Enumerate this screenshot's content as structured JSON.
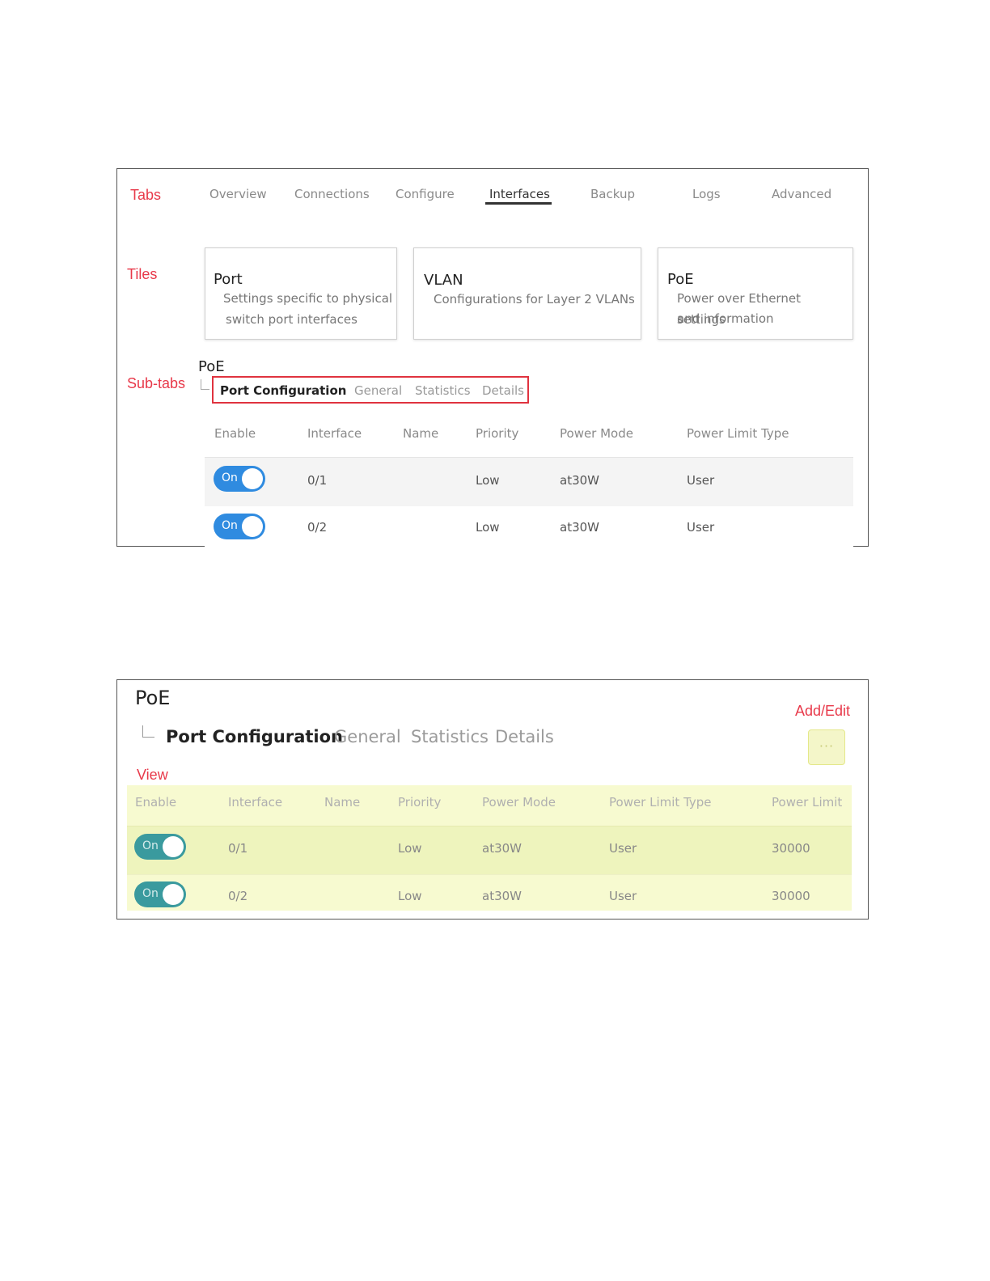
{
  "figure1": {
    "annotations": {
      "tabs": "Tabs",
      "tiles": "Tiles",
      "subtabs": "Sub-tabs"
    },
    "tabs": [
      "Overview",
      "Connections",
      "Configure",
      "Interfaces",
      "Backup",
      "Logs",
      "Advanced"
    ],
    "active_tab": "Interfaces",
    "tiles": [
      {
        "title": "Port",
        "desc_line1": "Settings specific to physical",
        "desc_line2": "switch port interfaces"
      },
      {
        "title": "VLAN",
        "desc_line1": "Configurations for Layer 2 VLANs",
        "desc_line2": ""
      },
      {
        "title": "PoE",
        "desc_line1": "Power over Ethernet settings",
        "desc_line2": "and information"
      }
    ],
    "section_title": "PoE",
    "subtabs": [
      "Port Configuration",
      "General",
      "Statistics",
      "Details"
    ],
    "table": {
      "headers": [
        "Enable",
        "Interface",
        "Name",
        "Priority",
        "Power Mode",
        "Power Limit Type"
      ],
      "rows": [
        {
          "enable": "On",
          "interface": "0/1",
          "name": "",
          "priority": "Low",
          "power_mode": "at30W",
          "power_limit_type": "User"
        },
        {
          "enable": "On",
          "interface": "0/2",
          "name": "",
          "priority": "Low",
          "power_mode": "at30W",
          "power_limit_type": "User"
        }
      ]
    }
  },
  "figure2": {
    "title": "PoE",
    "subtabs": [
      "Port Configuration",
      "General",
      "Statistics",
      "Details"
    ],
    "annotations": {
      "add_edit": "Add/Edit",
      "view": "View"
    },
    "more_button_label": "···",
    "table": {
      "headers": [
        "Enable",
        "Interface",
        "Name",
        "Priority",
        "Power Mode",
        "Power Limit Type",
        "Power Limit"
      ],
      "rows": [
        {
          "enable": "On",
          "interface": "0/1",
          "name": "",
          "priority": "Low",
          "power_mode": "at30W",
          "power_limit_type": "User",
          "power_limit": "30000"
        },
        {
          "enable": "On",
          "interface": "0/2",
          "name": "",
          "priority": "Low",
          "power_mode": "at30W",
          "power_limit_type": "User",
          "power_limit": "30000"
        }
      ]
    }
  },
  "colors": {
    "annotation_red": "#e8394a",
    "toggle_blue": "#2f8be0",
    "toggle_teal": "#3a9a9e",
    "highlight_yellow": "#f7fad0"
  }
}
